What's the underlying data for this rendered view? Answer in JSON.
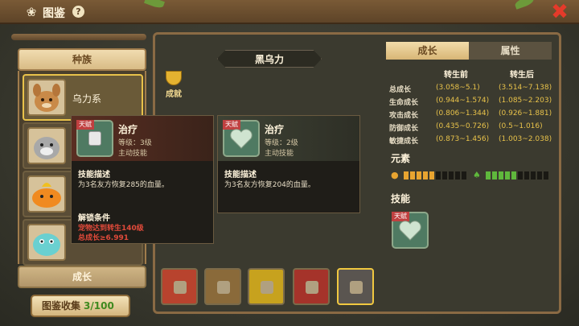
{
  "header": {
    "title": "图鉴",
    "help_icon": "question-icon",
    "paw_icon": "paw-icon",
    "close_icon": "close-icon"
  },
  "sidebar": {
    "header_label": "种族",
    "items": [
      {
        "label": "乌力系",
        "selected": true
      },
      {
        "label": "",
        "selected": false
      },
      {
        "label": "",
        "selected": false
      },
      {
        "label": "",
        "selected": false
      }
    ],
    "footer_label": "成长",
    "collect_label": "图鉴收集",
    "collect_count": "3/100"
  },
  "pet": {
    "name": "黑乌力",
    "achievement_label": "成就"
  },
  "tooltip_left": {
    "tag": "天赋",
    "name": "治疗",
    "level": "等级：3级",
    "type": "主动技能",
    "desc_title": "技能描述",
    "desc_text": "为3名友方恢复285的血量。",
    "unlock_title": "解锁条件",
    "unlock_line1": "宠物达到转生140级",
    "unlock_line2": "总成长≥6.991"
  },
  "tooltip_right": {
    "tag": "天赋",
    "name": "治疗",
    "level": "等级：2级",
    "type": "主动技能",
    "desc_title": "技能描述",
    "desc_text": "为3名友方恢复204的血量。"
  },
  "skins": [
    {
      "color": "#b8432e",
      "selected": false
    },
    {
      "color": "#8a6a3a",
      "selected": false
    },
    {
      "color": "#c7a21e",
      "selected": false
    },
    {
      "color": "#a5332a",
      "selected": false
    },
    {
      "color": "#5a5550",
      "selected": true
    }
  ],
  "tabs": {
    "growth": "成长",
    "attributes": "属性"
  },
  "stats": {
    "col_before": "转生前",
    "col_after": "转生后",
    "rows": [
      {
        "label": "总成长",
        "before": "(3.058~5.1)",
        "after": "(3.514~7.138)"
      },
      {
        "label": "生命成长",
        "before": "(0.944~1.574)",
        "after": "(1.085~2.203)"
      },
      {
        "label": "攻击成长",
        "before": "(0.806~1.344)",
        "after": "(0.926~1.881)"
      },
      {
        "label": "防御成长",
        "before": "(0.435~0.726)",
        "after": "(0.5~1.016)"
      },
      {
        "label": "敏捷成长",
        "before": "(0.873~1.456)",
        "after": "(1.003~2.038)"
      }
    ]
  },
  "elements": {
    "title": "元素",
    "earth": {
      "icon": "earth-icon",
      "filled": 5,
      "total": 10,
      "color": "#e8a430"
    },
    "wood": {
      "icon": "leaf-icon",
      "filled": 5,
      "total": 10,
      "color": "#5fb83c"
    }
  },
  "skills_title": "技能",
  "skill_tag": "天赋"
}
